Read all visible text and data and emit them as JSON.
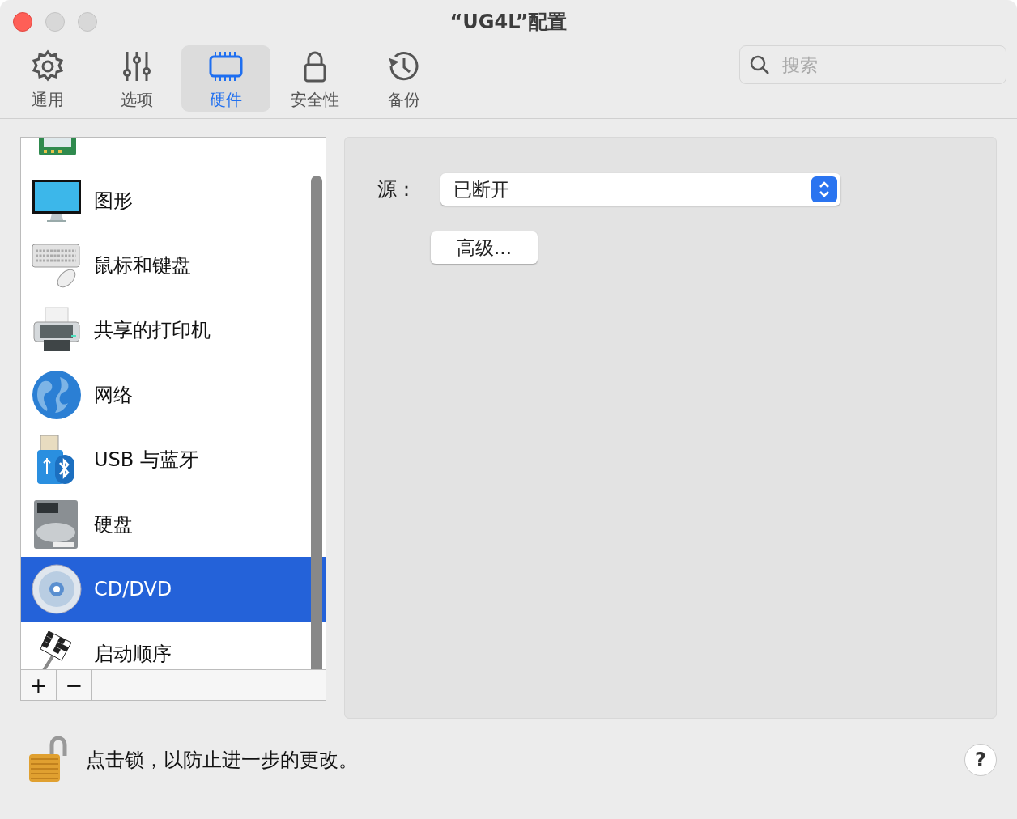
{
  "window": {
    "title": "“UG4L”配置"
  },
  "toolbar": {
    "tabs": [
      {
        "label": "通用",
        "kind": "gear",
        "selected": false
      },
      {
        "label": "选项",
        "kind": "sliders",
        "selected": false
      },
      {
        "label": "硬件",
        "kind": "chip",
        "selected": true
      },
      {
        "label": "安全性",
        "kind": "lock",
        "selected": false
      },
      {
        "label": "备份",
        "kind": "history",
        "selected": false
      }
    ],
    "search": {
      "placeholder": "搜索"
    }
  },
  "device_list": {
    "partial_item": {
      "kind": "cpu"
    },
    "items": [
      {
        "label": "图形",
        "kind": "monitor",
        "selected": false
      },
      {
        "label": "鼠标和键盘",
        "kind": "keyboard",
        "selected": false
      },
      {
        "label": "共享的打印机",
        "kind": "printer",
        "selected": false
      },
      {
        "label": "网络",
        "kind": "globe",
        "selected": false
      },
      {
        "label": "USB 与蓝牙",
        "kind": "usb",
        "selected": false
      },
      {
        "label": "硬盘",
        "kind": "disk",
        "selected": false
      },
      {
        "label": "CD/DVD",
        "kind": "cd",
        "selected": true
      },
      {
        "label": "启动顺序",
        "kind": "flag",
        "selected": false
      }
    ],
    "buttons": [
      "+",
      "−"
    ]
  },
  "detail": {
    "source_label": "源：",
    "source_value": "已断开",
    "advanced_button": "高级..."
  },
  "footer": {
    "lock_text": "点击锁，以防止进一步的更改。",
    "help_button": "?"
  }
}
